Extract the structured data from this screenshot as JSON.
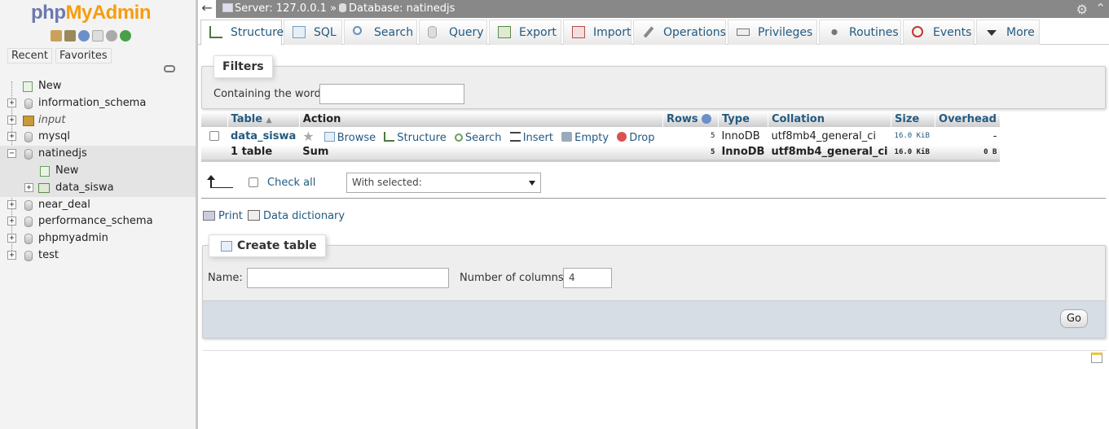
{
  "nav": {
    "logo_a": "php",
    "logo_b": "MyAdmin",
    "tabs": [
      "Recent",
      "Favorites"
    ],
    "tree": [
      {
        "label": "New",
        "type": "new"
      },
      {
        "label": "information_schema",
        "type": "db"
      },
      {
        "label": "input",
        "type": "db-italic"
      },
      {
        "label": "mysql",
        "type": "db"
      },
      {
        "label": "natinedjs",
        "type": "db-open"
      },
      {
        "label": "New",
        "type": "sub-new"
      },
      {
        "label": "data_siswa",
        "type": "sub-table"
      },
      {
        "label": "near_deal",
        "type": "db"
      },
      {
        "label": "performance_schema",
        "type": "db"
      },
      {
        "label": "phpmyadmin",
        "type": "db"
      },
      {
        "label": "test",
        "type": "db"
      }
    ]
  },
  "topbar": {
    "back": "←",
    "server": "Server: 127.0.0.1",
    "sep": "»",
    "database": "Database: natinedjs"
  },
  "menu": [
    {
      "label": "Structure",
      "icon": "structure-icon",
      "active": true
    },
    {
      "label": "SQL",
      "icon": "sql-icon"
    },
    {
      "label": "Search",
      "icon": "search-icon"
    },
    {
      "label": "Query",
      "icon": "query-icon"
    },
    {
      "label": "Export",
      "icon": "export-icon"
    },
    {
      "label": "Import",
      "icon": "import-icon"
    },
    {
      "label": "Operations",
      "icon": "wrench-icon"
    },
    {
      "label": "Privileges",
      "icon": "privileges-icon"
    },
    {
      "label": "Routines",
      "icon": "routines-icon"
    },
    {
      "label": "Events",
      "icon": "clock-icon"
    },
    {
      "label": "More",
      "icon": "caret-down-icon"
    }
  ],
  "filters": {
    "legend": "Filters",
    "label": "Containing the word:",
    "value": ""
  },
  "table": {
    "headers": {
      "table": "Table",
      "sort": "▲",
      "action": "Action",
      "rows": "Rows",
      "type": "Type",
      "collation": "Collation",
      "size": "Size",
      "overhead": "Overhead"
    },
    "row": {
      "name": "data_siswa",
      "actions": [
        "Browse",
        "Structure",
        "Search",
        "Insert",
        "Empty",
        "Drop"
      ],
      "rows": "5",
      "type": "InnoDB",
      "collation": "utf8mb4_general_ci",
      "size": "16.0 KiB",
      "overhead": "-"
    },
    "sum": {
      "count": "1 table",
      "label": "Sum",
      "rows": "5",
      "type": "InnoDB",
      "collation": "utf8mb4_general_ci",
      "size": "16.0 KiB",
      "overhead": "0 B"
    }
  },
  "bulk": {
    "check_all": "Check all",
    "with_selected": "With selected:"
  },
  "links": {
    "print": "Print",
    "data_dictionary": "Data dictionary"
  },
  "create": {
    "legend": "Create table",
    "name_label": "Name:",
    "name_value": "",
    "cols_label": "Number of columns:",
    "cols_value": "4",
    "go": "Go"
  },
  "colors": {
    "link": "#235a81",
    "topbar": "#888888",
    "logo_a": "#6c78af",
    "logo_b": "#f89c0e"
  }
}
